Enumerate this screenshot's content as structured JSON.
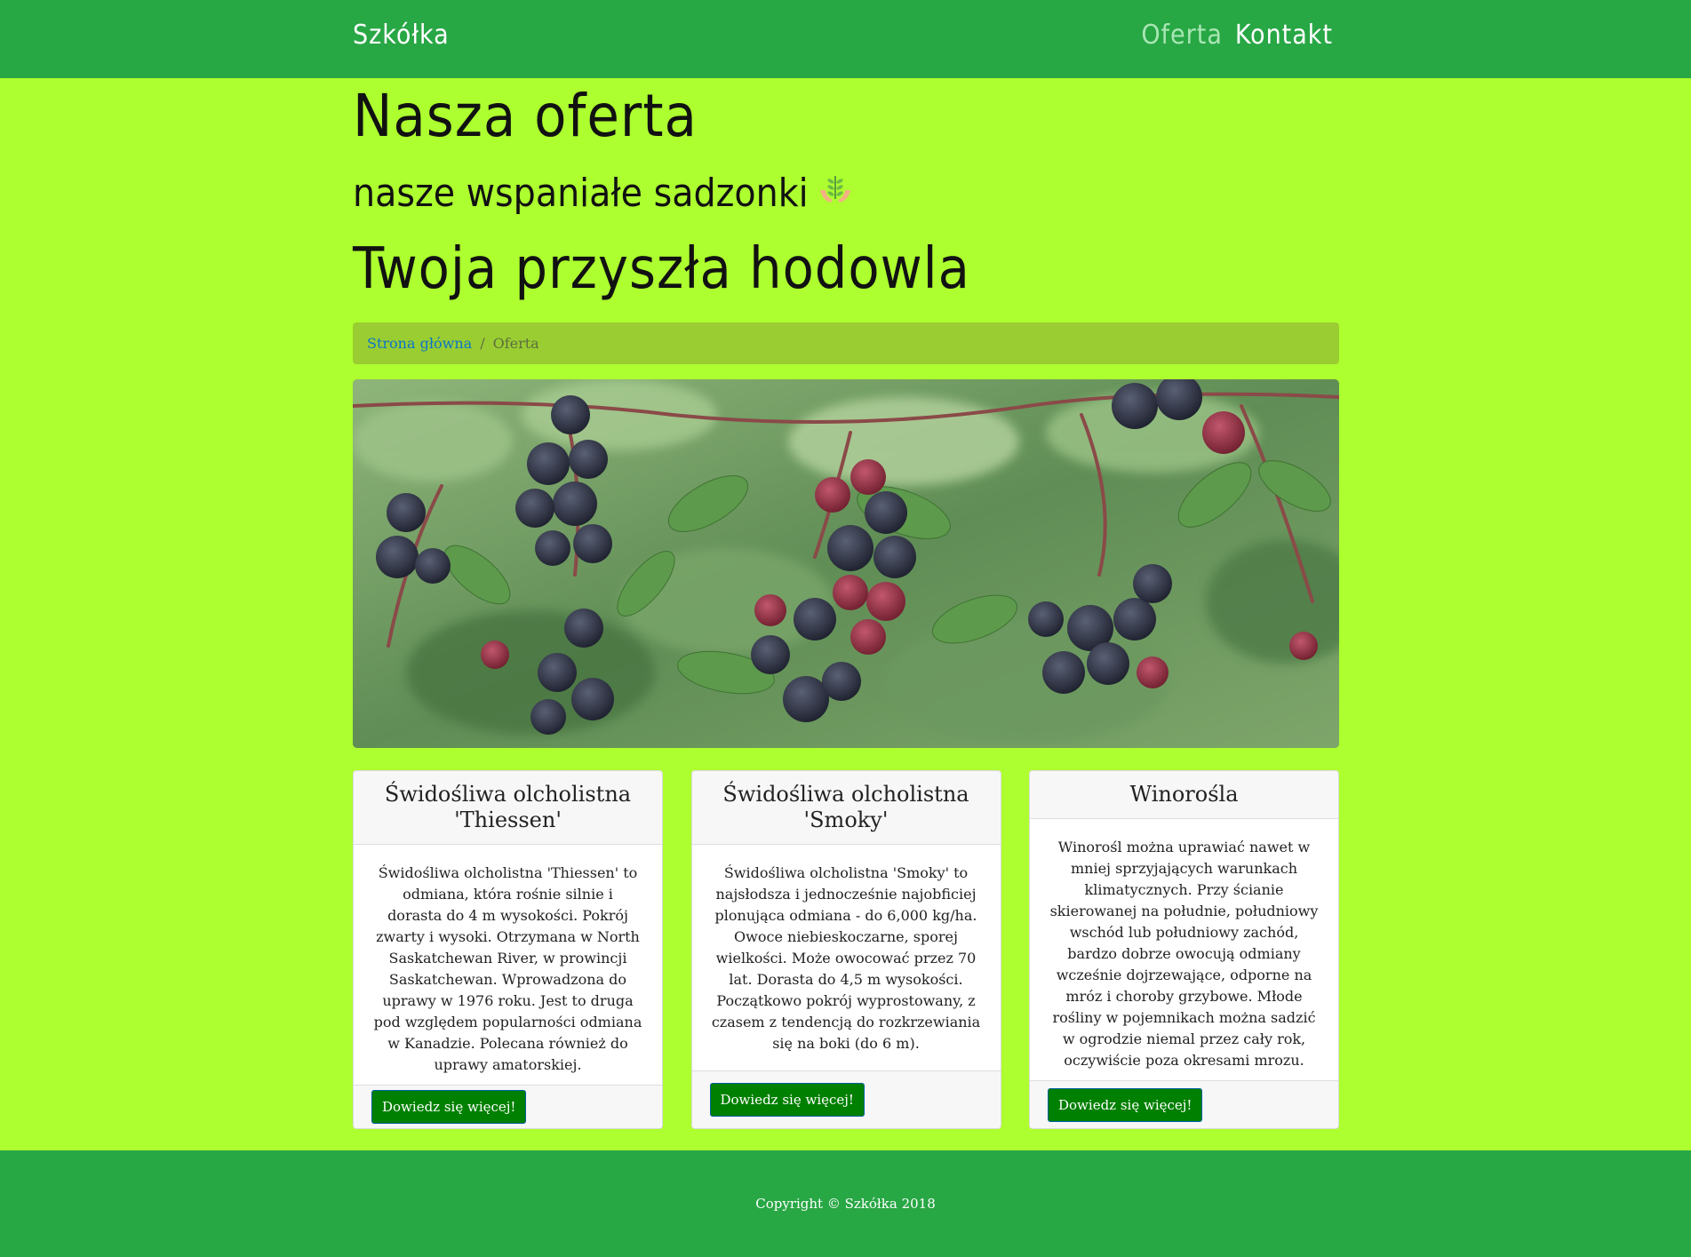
{
  "navbar": {
    "brand": "Szkółka",
    "links": [
      {
        "label": "Oferta",
        "active": true
      },
      {
        "label": "Kontakt",
        "active": false
      }
    ]
  },
  "headings": {
    "main": "Nasza oferta",
    "sub": "nasze wspaniałe sadzonki",
    "sub_icon": "seedling-hands-icon",
    "third": "Twoja przyszła hodowla"
  },
  "breadcrumb": {
    "home": "Strona główna",
    "separator": "/",
    "current": "Oferta"
  },
  "hero": {
    "icon": "berries-photo"
  },
  "cards": [
    {
      "title": "Świdośliwa olcholistna 'Thiessen'",
      "body": "Świdośliwa olcholistna 'Thiessen' to odmiana, która rośnie silnie i dorasta do 4 m wysokości. Pokrój zwarty i wysoki. Otrzymana w North Saskatchewan River, w prowincji Saskatchewan. Wprowadzona do uprawy w 1976 roku. Jest to druga pod względem popularności odmiana w Kanadzie. Polecana również do uprawy amatorskiej.",
      "button": "Dowiedz się więcej!"
    },
    {
      "title": "Świdośliwa olcholistna 'Smoky'",
      "body": "Świdośliwa olcholistna 'Smoky' to najsłodsza i jednocześnie najobficiej plonująca odmiana - do 6,000 kg/ha. Owoce niebieskoczarne, sporej wielkości. Może owocować przez 70 lat. Dorasta do 4,5 m wysokości. Początkowo pokrój wyprostowany, z czasem z tendencją do rozkrzewiania się na boki (do 6 m).",
      "button": "Dowiedz się więcej!"
    },
    {
      "title": "Winorośla",
      "body": "Winorośl można uprawiać nawet w mniej sprzyjających warunkach klimatycznych. Przy ścianie skierowanej na południe, południowy wschód lub południowy zachód, bardzo dobrze owocują odmiany wcześnie dojrzewające, odporne na mróz i choroby grzybowe. Młode rośliny w pojemnikach można sadzić w ogrodzie niemal przez cały rok, oczywiście poza okresami mrozu.",
      "button": "Dowiedz się więcej!"
    }
  ],
  "footer": {
    "copyright": "Copyright © Szkółka 2018"
  },
  "colors": {
    "navbar": "#28a745",
    "page_background": "#adff2f",
    "breadcrumb_background": "#9acd32",
    "button": "#008000",
    "link": "#0a74c9"
  }
}
